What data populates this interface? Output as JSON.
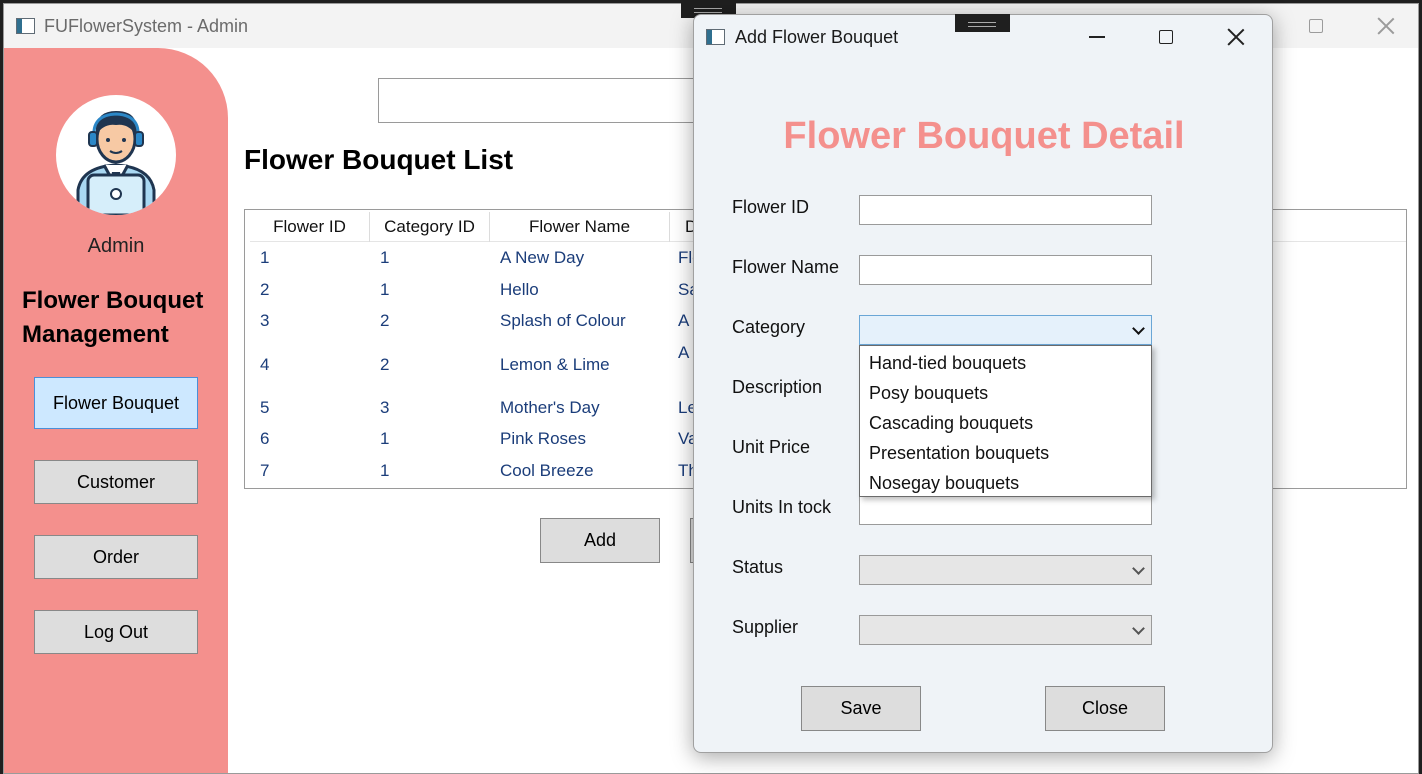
{
  "main_window": {
    "title": "FUFlowerSystem - Admin"
  },
  "sidebar": {
    "admin_label": "Admin",
    "heading": "Flower Bouquet Management",
    "buttons": [
      {
        "label": "Flower Bouquet",
        "active": true
      },
      {
        "label": "Customer"
      },
      {
        "label": "Order"
      },
      {
        "label": "Log Out"
      }
    ]
  },
  "main": {
    "search_value": "",
    "list_title": "Flower Bouquet List",
    "grid": {
      "columns": [
        "Flower ID",
        "Category ID",
        "Flower Name",
        "D"
      ],
      "rows": [
        {
          "flower_id": "1",
          "category_id": "1",
          "flower_name": "A New Day",
          "desc": "Flo"
        },
        {
          "flower_id": "2",
          "category_id": "1",
          "flower_name": "Hello",
          "desc": "Sa"
        },
        {
          "flower_id": "3",
          "category_id": "2",
          "flower_name": "Splash of Colour",
          "desc": "A"
        },
        {
          "flower_id": "4",
          "category_id": "2",
          "flower_name": "Lemon & Lime",
          "desc": "A"
        },
        {
          "flower_id": "5",
          "category_id": "3",
          "flower_name": "Mother's Day",
          "desc": "Le"
        },
        {
          "flower_id": "6",
          "category_id": "1",
          "flower_name": "Pink Roses",
          "desc": "Va"
        },
        {
          "flower_id": "7",
          "category_id": "1",
          "flower_name": "Cool Breeze",
          "desc": "Th"
        }
      ]
    },
    "add_label": "Add"
  },
  "dialog": {
    "title": "Add Flower Bouquet",
    "heading": "Flower Bouquet Detail",
    "labels": {
      "flower_id": "Flower ID",
      "flower_name": "Flower Name",
      "category": "Category",
      "description": "Description",
      "unit_price": "Unit Price",
      "units_in_stock": "Units In tock",
      "status": "Status",
      "supplier": "Supplier"
    },
    "category_options": [
      "Hand-tied bouquets",
      "Posy bouquets",
      "Cascading bouquets",
      "Presentation bouquets",
      "Nosegay bouquets"
    ],
    "save_label": "Save",
    "close_label": "Close"
  },
  "colors": {
    "sidebar_bg": "#f4908d",
    "heading_accent": "#f4908d",
    "active_button": "#cde8ff",
    "grid_text": "#1b3d7a",
    "dialog_bg": "#eff3f7"
  }
}
